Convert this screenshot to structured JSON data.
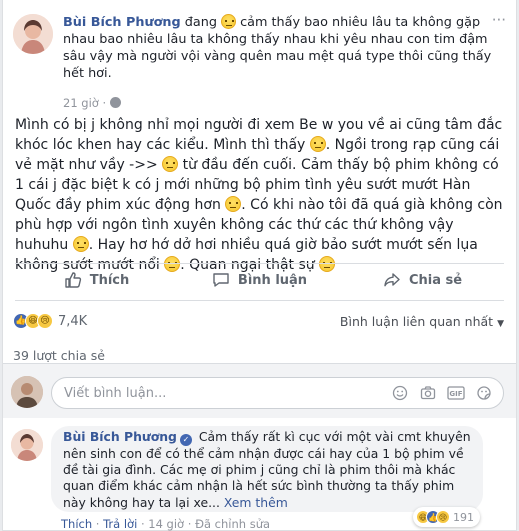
{
  "header": {
    "author": "Bùi Bích Phương",
    "status_prefix": "đang",
    "status_text": "cảm thấy bao nhiêu lâu ta không gặp nhau bao nhiêu lâu ta không thấy nhau khi yêu nhau con tim đậm sâu vậy mà người vội vàng quên mau mệt quá type thôi cũng thấy hết hơi.",
    "time": "21 giờ",
    "more": "···"
  },
  "post": {
    "p1": "Mình có bị j không nhỉ mọi người đi xem Be w you về ai cũng tâm đắc khóc lóc khen hay các kiểu. Mình thì thấy",
    "p2": ". Ngồi trong rạp cũng cái vẻ mặt như vầy ->>",
    "p3": "từ đầu đến cuối. Cảm thấy bộ phim không có 1 cái j đặc biệt k có j mới những bộ phim tình yêu sướt mướt Hàn Quốc đầy phim xúc động hơn",
    "p4": ". Có khi nào tôi đã quá già không còn phù hợp với ngôn tình xuyên không các thứ các thứ không vậy huhuhu",
    "p5": ". Hay hơ hớ dở hơi nhiều quá giờ bảo sướt mướt sến lụa không sướt mướt nổi",
    "p6": ". Quan ngại thật sự"
  },
  "actions": {
    "like": "Thích",
    "comment": "Bình luận",
    "share": "Chia sẻ"
  },
  "reactions": {
    "count": "7,4K",
    "related": "Bình luận liên quan nhất"
  },
  "shares": "39 lượt chia sẻ",
  "composer": {
    "placeholder": "Viết bình luận..."
  },
  "comment": {
    "author": "Bùi Bích Phương",
    "text": "Cảm thấy rất kì cục với một vài cmt khuyên nên sinh con để có thể cảm nhận được cái hay của 1 bộ phim về đề tài gia đình. Các mẹ ơi phim j cũng chỉ là phim thôi mà khác quan điểm khác cảm nhận là hết sức bình thường ta thấy phim này không hay ta lại xe...",
    "see_more": "Xem thêm",
    "reaction_count": "191",
    "like": "Thích",
    "reply": "Trả lời",
    "time": "14 giờ",
    "edited": "Đã chỉnh sửa"
  }
}
